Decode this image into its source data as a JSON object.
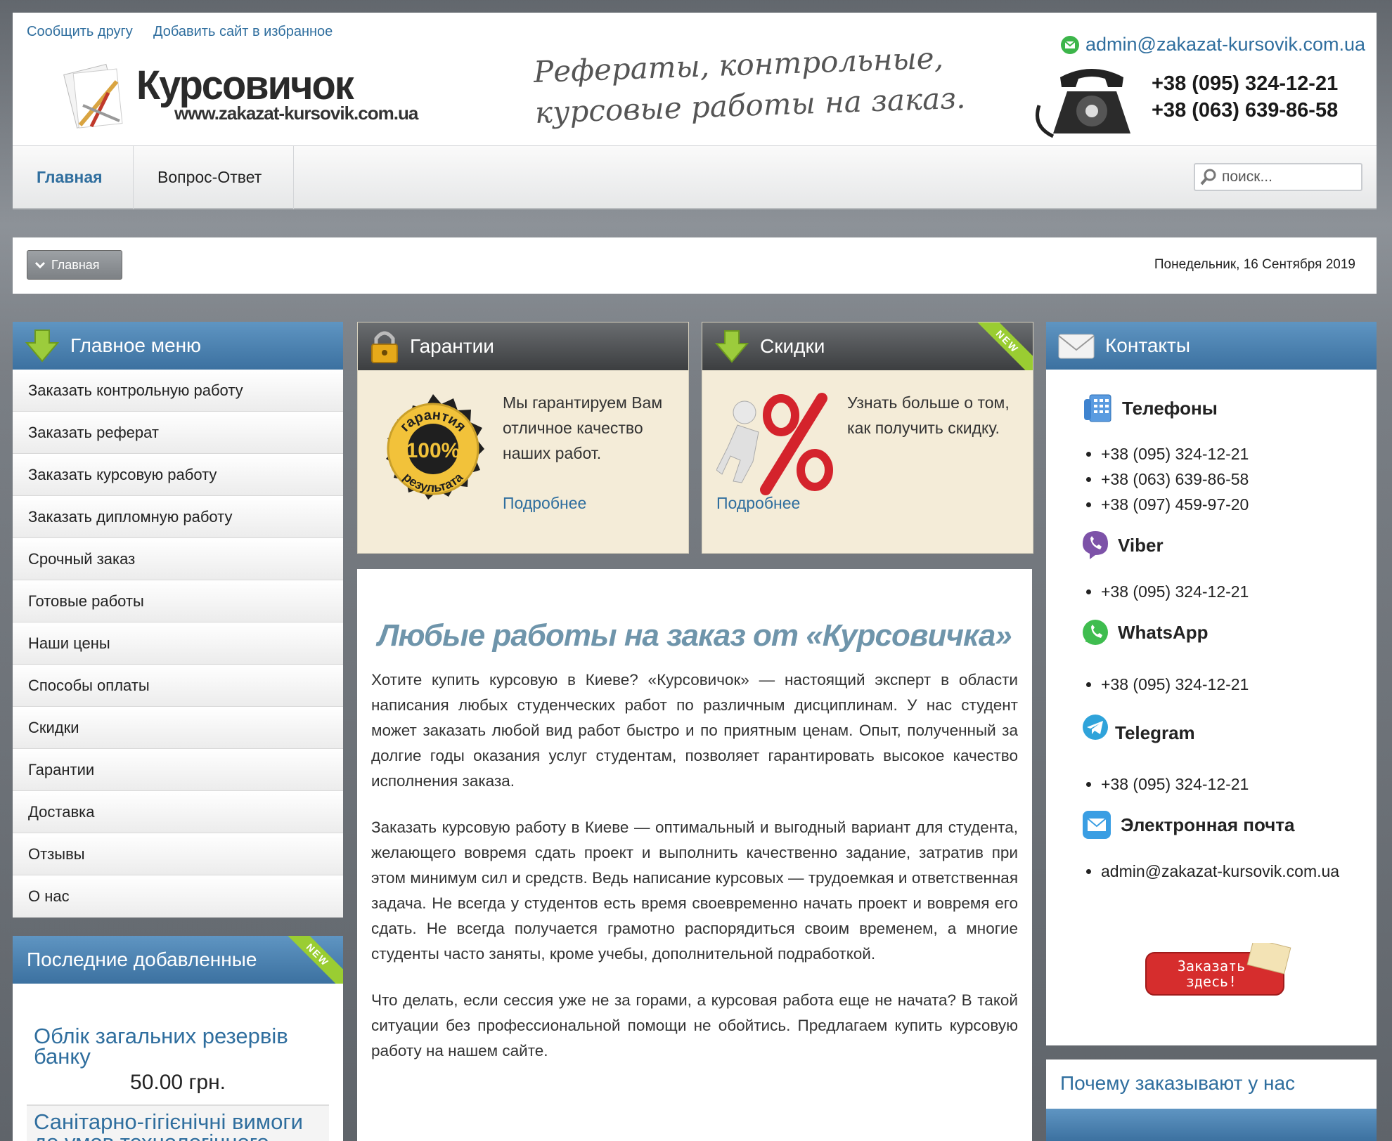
{
  "header": {
    "top_links": [
      "Сообщить другу",
      "Добавить сайт в избранное"
    ],
    "logo_title": "Курсовичок",
    "logo_url": "www.zakazat-kursovik.com.ua",
    "tagline_1": "Рефераты, контрольные,",
    "tagline_2": "курсовые работы на заказ.",
    "email": "admin@zakazat-kursovik.com.ua",
    "phone_1": "+38 (095) 324-12-21",
    "phone_2": "+38 (063) 639-86-58"
  },
  "nav": {
    "items": [
      "Главная",
      "Вопрос-Ответ"
    ],
    "search_placeholder": "поиск..."
  },
  "breadcrumb": {
    "label": "Главная",
    "date": "Понедельник, 16 Сентября 2019"
  },
  "menu": {
    "title": "Главное меню",
    "items": [
      "Заказать контрольную работу",
      "Заказать реферат",
      "Заказать курсовую работу",
      "Заказать дипломную работу",
      "Срочный заказ",
      "Готовые работы",
      "Наши цены",
      "Способы оплаты",
      "Скидки",
      "Гарантии",
      "Доставка",
      "Отзывы",
      "О нас"
    ]
  },
  "latest": {
    "title": "Последние добавленные",
    "ribbon": "NEW",
    "items": [
      {
        "title": "Облік загальних резервів банку",
        "price": "50.00 грн."
      },
      {
        "title": "Санітарно-гігієнічні вимоги до умов технологічного"
      }
    ]
  },
  "guarantee": {
    "title": "Гарантии",
    "seal_top": "гарантия",
    "seal_center": "100%",
    "seal_bottom": "результата",
    "text": "Мы гарантируем Вам отличное качество наших работ.",
    "link": "Подробнее"
  },
  "discount": {
    "title": "Скидки",
    "ribbon": "NEW",
    "text": "Узнать больше о том, как получить скидку.",
    "link": "Подробнее"
  },
  "article": {
    "heading": "Любые работы на заказ от «Курсовичка»",
    "paragraphs": [
      "Хотите купить курсовую в Киеве? «Курсовичок» — настоящий эксперт в области написания любых студенческих работ по различным дисциплинам. У нас студент может заказать любой вид работ быстро и по приятным ценам. Опыт, полученный за долгие годы оказания услуг студентам, позволяет гарантировать высокое качество исполнения заказа.",
      "Заказать курсовую работу в Киеве — оптимальный и выгодный вариант для студента, желающего вовремя сдать проект и выполнить качественно задание, затратив при этом минимум сил и средств. Ведь написание курсовых — трудоемкая и ответственная задача. Не всегда у студентов есть время своевременно начать проект и вовремя его сдать. Не всегда получается грамотно распорядиться своим временем, а многие студенты часто заняты, кроме учебы, дополнительной подработкой.",
      "Что делать, если сессия уже не за горами, а курсовая работа еще не начата? В такой ситуации без профессиональной помощи не обойтись. Предлагаем купить курсовую работу на нашем сайте."
    ]
  },
  "contacts": {
    "title": "Контакты",
    "phones_label": "Телефоны",
    "phones": [
      "+38 (095) 324-12-21",
      "+38 (063) 639-86-58",
      "+38 (097) 459-97-20"
    ],
    "viber_label": "Viber",
    "viber": [
      "+38 (095) 324-12-21"
    ],
    "whatsapp_label": "WhatsApp",
    "whatsapp": [
      "+38 (095) 324-12-21"
    ],
    "telegram_label": "Telegram",
    "telegram": [
      "+38 (095) 324-12-21"
    ],
    "email_label": "Электронная почта",
    "email": [
      "admin@zakazat-kursovik.com.ua"
    ],
    "order_button": "Заказать здесь!"
  },
  "why": {
    "title": "Почему заказывают у нас"
  }
}
